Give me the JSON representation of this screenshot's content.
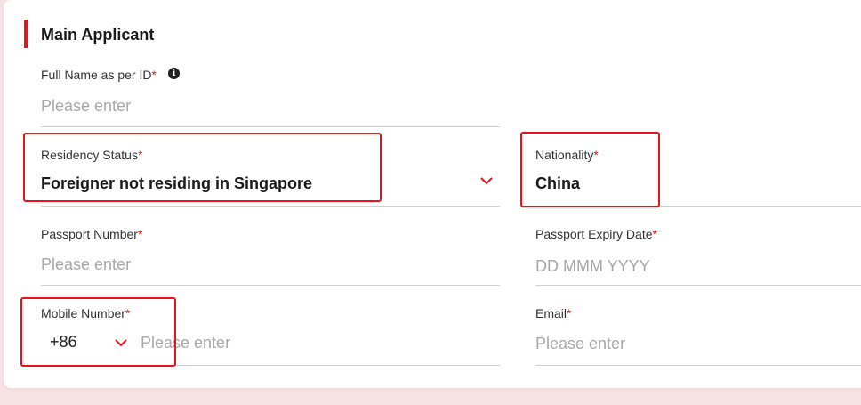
{
  "section": {
    "title": "Main Applicant"
  },
  "full_name": {
    "label": "Full Name as per ID",
    "required": "*",
    "placeholder": "Please enter",
    "info_icon": "i"
  },
  "residency": {
    "label": "Residency Status",
    "required": "*",
    "value": "Foreigner not residing in Singapore"
  },
  "nationality": {
    "label": "Nationality",
    "required": "*",
    "value": "China"
  },
  "passport_number": {
    "label": "Passport Number",
    "required": "*",
    "placeholder": "Please enter"
  },
  "passport_expiry": {
    "label": "Passport Expiry Date",
    "required": "*",
    "placeholder": "DD MMM YYYY"
  },
  "mobile": {
    "label": "Mobile Number",
    "required": "*",
    "country_code": "+86",
    "placeholder": "Please enter"
  },
  "email": {
    "label": "Email",
    "required": "*",
    "placeholder": "Please enter"
  },
  "colors": {
    "accent": "#e8141c",
    "placeholder": "#a8a8a8",
    "underline": "#d0d0d0"
  }
}
